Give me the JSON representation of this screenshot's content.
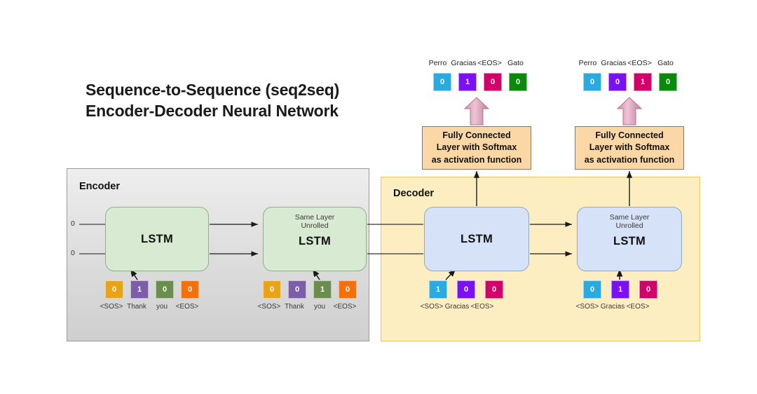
{
  "title": {
    "line1": "Sequence-to-Sequence (seq2seq)",
    "line2": "Encoder-Decoder Neural Network"
  },
  "encoder": {
    "panel_label": "Encoder",
    "initial_state_labels": [
      "0",
      "0"
    ],
    "cells": [
      {
        "name": "LSTM",
        "note_line1": "",
        "note_line2": ""
      },
      {
        "name": "LSTM",
        "note_line1": "Same Layer",
        "note_line2": "Unrolled"
      }
    ],
    "timesteps": [
      {
        "labels": [
          "<SOS>",
          "Thank",
          "you",
          "<EOS>"
        ],
        "values": [
          "0",
          "1",
          "0",
          "0"
        ],
        "active_index": 1
      },
      {
        "labels": [
          "<SOS>",
          "Thank",
          "you",
          "<EOS>"
        ],
        "values": [
          "0",
          "0",
          "1",
          "0"
        ],
        "active_index": 2
      }
    ],
    "vocab_colors": [
      "#e8a317",
      "#7b5ea7",
      "#6b8e4e",
      "#f4700a"
    ]
  },
  "decoder": {
    "panel_label": "Decoder",
    "cells": [
      {
        "name": "LSTM",
        "note_line1": "",
        "note_line2": ""
      },
      {
        "name": "LSTM",
        "note_line1": "Same Layer",
        "note_line2": "Unrolled"
      }
    ],
    "timesteps": [
      {
        "labels": [
          "<SOS>",
          "Gracias",
          "<EOS>"
        ],
        "values": [
          "1",
          "0",
          "0"
        ],
        "active_index": 0
      },
      {
        "labels": [
          "<SOS>",
          "Gracias",
          "<EOS>"
        ],
        "values": [
          "0",
          "1",
          "0"
        ],
        "active_index": 1
      }
    ],
    "input_vocab_colors": [
      "#29abe2",
      "#7b0ff5",
      "#d4006a"
    ]
  },
  "fully_connected": {
    "label_line1": "Fully Connected",
    "label_line2": "Layer with Softmax",
    "label_line3": "as activation function",
    "box_color": "#fbd7a5",
    "arrow_color": "#d98fb0"
  },
  "outputs": [
    {
      "labels": [
        "Perro",
        "Gracias",
        "<EOS>",
        "Gato"
      ],
      "values": [
        "0",
        "1",
        "0",
        "0"
      ],
      "active_index": 1
    },
    {
      "labels": [
        "Perro",
        "Gracias",
        "<EOS>",
        "Gato"
      ],
      "values": [
        "0",
        "0",
        "1",
        "0"
      ],
      "active_index": 2
    }
  ],
  "output_vocab_colors": [
    "#29abe2",
    "#7b0ff5",
    "#d4006a",
    "#0a8a0a"
  ],
  "theme": {
    "encoder_panel_bg": "#e2e2e2",
    "decoder_panel_bg": "#fdeec2",
    "encoder_cell_bg": "#d9ead3",
    "decoder_cell_bg": "#d5e2f7",
    "page_bg": "#ffffff"
  }
}
